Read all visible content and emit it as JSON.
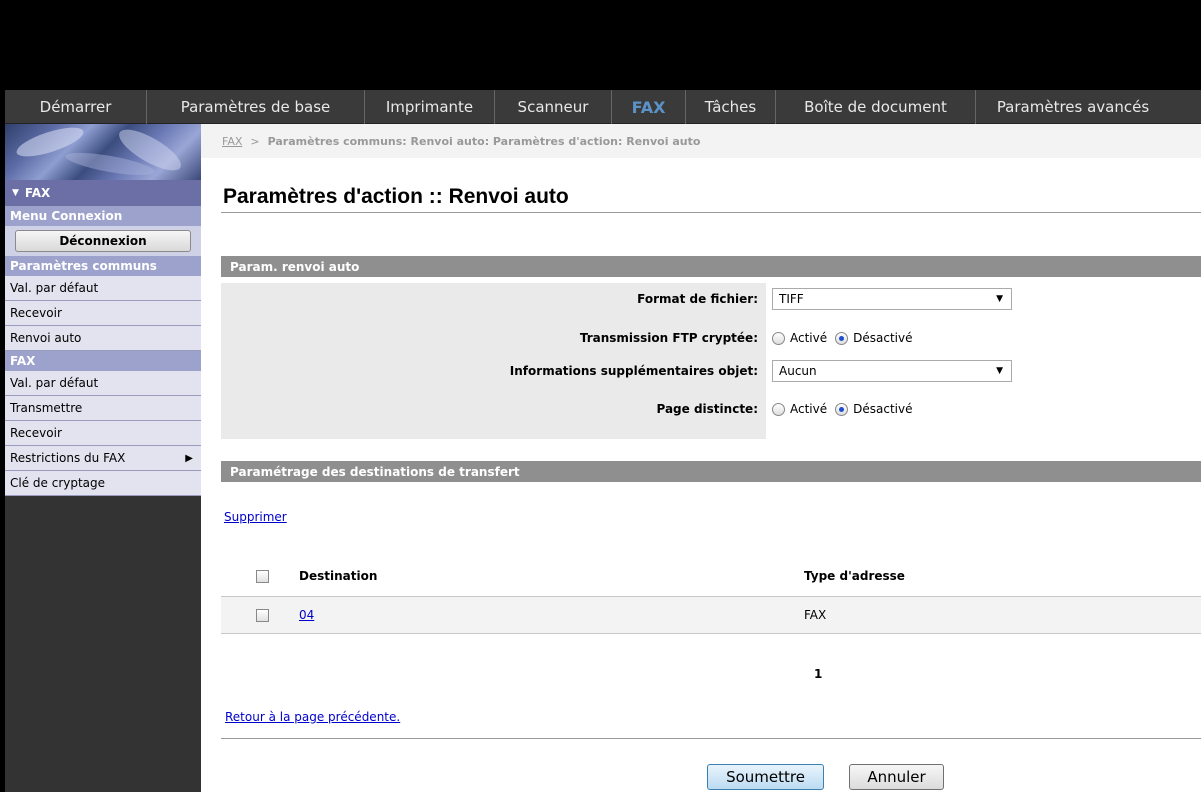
{
  "nav": {
    "tabs": [
      {
        "label": "Démarrer",
        "width": 142
      },
      {
        "label": "Paramètres de base",
        "width": 218
      },
      {
        "label": "Imprimante",
        "width": 130
      },
      {
        "label": "Scanneur",
        "width": 117
      },
      {
        "label": "FAX",
        "width": 74,
        "active": true
      },
      {
        "label": "Tâches",
        "width": 90
      },
      {
        "label": "Boîte de document",
        "width": 200
      },
      {
        "label": "Paramètres avancés",
        "width": 194
      }
    ],
    "active_color": "#5b93c8"
  },
  "sidebar": {
    "header": "FAX",
    "connection_menu": "Menu Connexion",
    "logout_label": "Déconnexion",
    "common_section": "Paramètres communs",
    "common_items": [
      "Val. par défaut",
      "Recevoir",
      "Renvoi auto"
    ],
    "fax_section": "FAX",
    "fax_items": [
      "Val. par défaut",
      "Transmettre",
      "Recevoir",
      "Restrictions du FAX",
      "Clé de cryptage"
    ]
  },
  "breadcrumb": {
    "root": "FAX",
    "separator": ">",
    "path": "Paramètres communs: Renvoi auto: Paramètres d'action: Renvoi auto"
  },
  "page_title": "Paramètres d'action :: Renvoi auto",
  "section1": {
    "title": "Param. renvoi auto",
    "file_format": {
      "label": "Format de fichier:",
      "value": "TIFF"
    },
    "ftp_encrypted": {
      "label": "Transmission FTP cryptée:",
      "option_on": "Activé",
      "option_off": "Désactivé",
      "selected": "off"
    },
    "subject_info": {
      "label": "Informations supplémentaires objet:",
      "value": "Aucun"
    },
    "separate_page": {
      "label": "Page distincte:",
      "option_on": "Activé",
      "option_off": "Désactivé",
      "selected": "off"
    }
  },
  "section2": {
    "title": "Paramétrage des destinations de transfert",
    "delete_label": "Supprimer",
    "columns": {
      "destination": "Destination",
      "address_type": "Type d'adresse"
    },
    "rows": [
      {
        "destination": "04",
        "address_type": "FAX"
      }
    ],
    "page_number": "1"
  },
  "back_link": "Retour à la page précédente.",
  "buttons": {
    "submit": "Soumettre",
    "cancel": "Annuler"
  }
}
